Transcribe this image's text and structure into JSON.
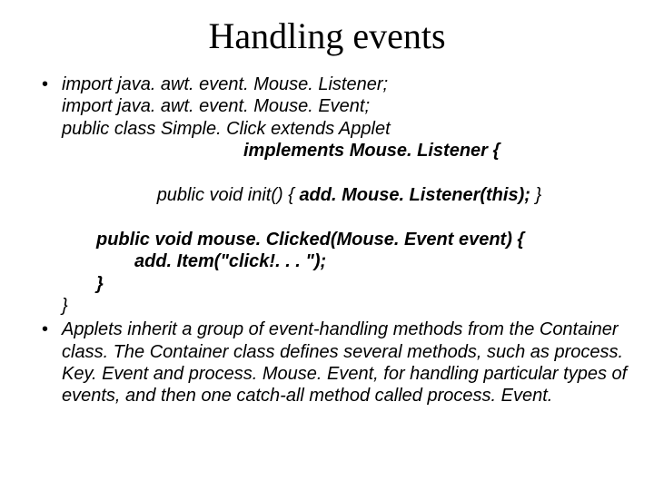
{
  "title": "Handling events",
  "bullet1": {
    "lines": {
      "l1": "import java. awt. event. Mouse. Listener;",
      "l2": "import java. awt. event. Mouse. Event;",
      "l3": "public class Simple. Click extends Applet",
      "l4": "implements Mouse. Listener {",
      "l5a": "public void init() { ",
      "l5b": "add. Mouse. Listener(this);",
      "l5c": " }",
      "l6": "public void mouse. Clicked(Mouse. Event event) {",
      "l7": "add. Item(\"click!. . . \");",
      "l8": "}",
      "l9": "}"
    }
  },
  "bullet2": {
    "text": "Applets inherit a group of event-handling methods from the Container class. The Container class defines several methods, such as process. Key. Event and process. Mouse. Event, for handling particular types of events, and then one catch-all method called process. Event."
  }
}
